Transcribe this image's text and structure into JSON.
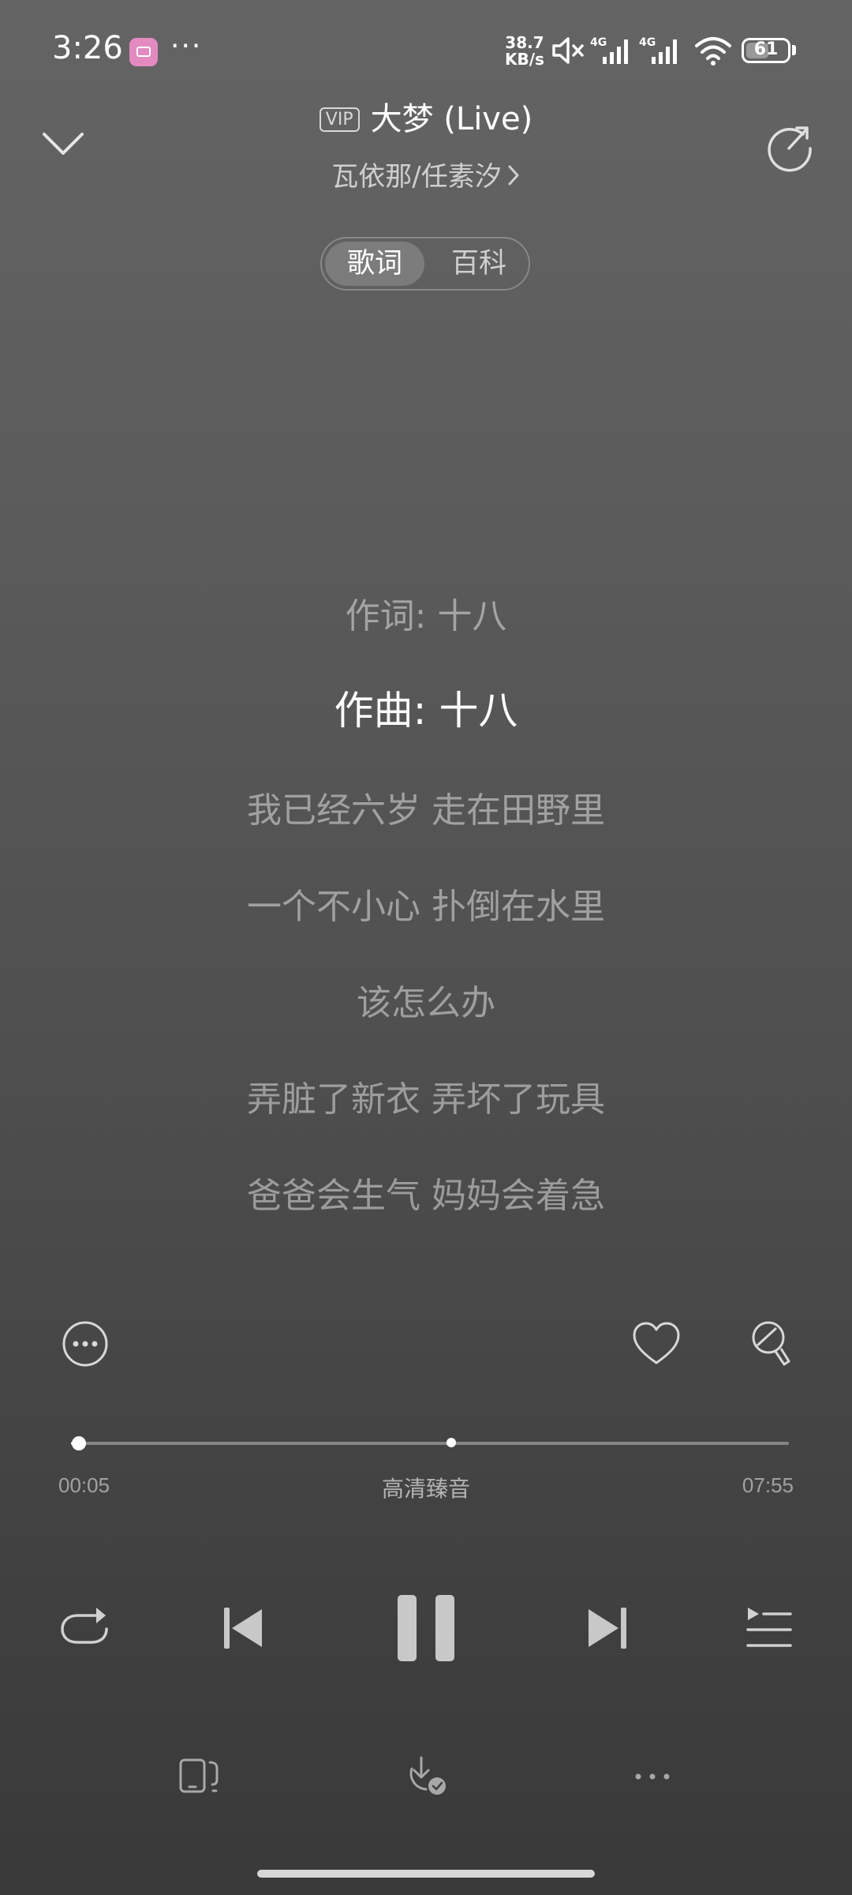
{
  "status_bar": {
    "time": "3:26",
    "more": "···",
    "net_speed_value": "38.7",
    "net_speed_unit": "KB/s",
    "network_1": "4G",
    "network_2": "4G",
    "battery": "61",
    "battery_level": 0.61
  },
  "header": {
    "vip_badge": "VIP",
    "title": "大梦 (Live)",
    "artist": "瓦依那/任素汐"
  },
  "tabs": [
    {
      "label": "歌词",
      "active": true
    },
    {
      "label": "百科",
      "active": false
    }
  ],
  "lyrics": [
    {
      "text": "作词: 十八",
      "active": false
    },
    {
      "text": "作曲: 十八",
      "active": true
    },
    {
      "text": "我已经六岁 走在田野里",
      "active": false
    },
    {
      "text": "一个不小心 扑倒在水里",
      "active": false
    },
    {
      "text": "该怎么办",
      "active": false
    },
    {
      "text": "弄脏了新衣 弄坏了玩具",
      "active": false
    },
    {
      "text": "爸爸会生气 妈妈会着急",
      "active": false
    }
  ],
  "player": {
    "current_time": "00:05",
    "total_time": "07:55",
    "progress": 0.011,
    "climax_marker": 0.53,
    "quality": "高清臻音"
  },
  "icons": {
    "collapse": "chevron-down-icon",
    "share": "share-icon",
    "more": "more-icon",
    "like": "heart-icon",
    "sing": "microphone-icon",
    "repeat": "repeat-icon",
    "prev": "previous-icon",
    "pause": "pause-icon",
    "next": "next-icon",
    "playlist": "playlist-icon",
    "device": "device-icon",
    "download": "download-icon",
    "options": "options-icon"
  },
  "colors": {
    "background_top": "#646464",
    "background_bottom": "#393939",
    "app_icon": "#e38ac1"
  }
}
